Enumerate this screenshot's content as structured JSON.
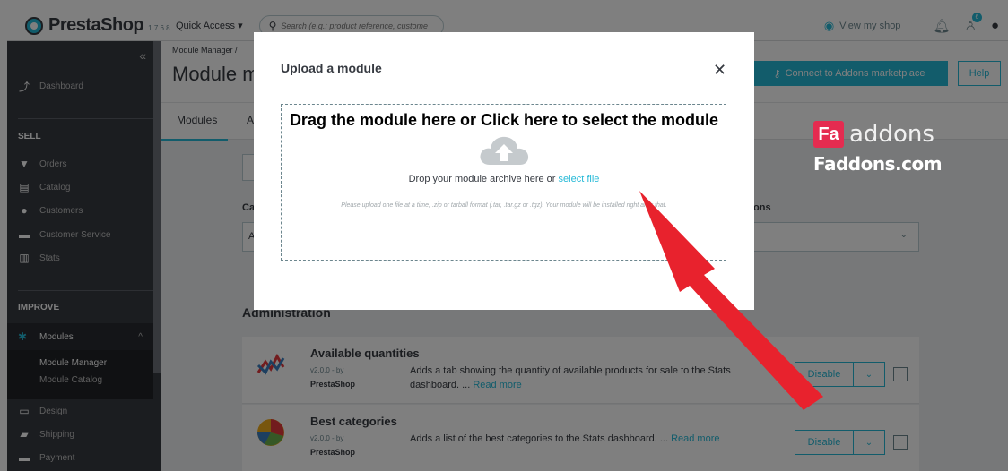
{
  "topbar": {
    "logo": "PrestaShop",
    "version": "1.7.6.8",
    "quick_access": "Quick Access ▾",
    "search_placeholder": "Search (e.g.: product reference, custome",
    "view_shop": "View my shop",
    "notif_badge": "6"
  },
  "sidebar": {
    "dashboard": "Dashboard",
    "sell": "SELL",
    "orders": "Orders",
    "catalog": "Catalog",
    "customers": "Customers",
    "customer_service": "Customer Service",
    "stats": "Stats",
    "improve": "IMPROVE",
    "modules": "Modules",
    "module_manager": "Module Manager",
    "module_catalog": "Module Catalog",
    "design": "Design",
    "shipping": "Shipping",
    "payment": "Payment"
  },
  "header": {
    "breadcrumb": "Module Manager /",
    "title": "Module m",
    "addons_button": "Connect to Addons marketplace",
    "help_button": "Help"
  },
  "tabs": {
    "modules": "Modules",
    "alerts": "A"
  },
  "filters": {
    "category_label": "Ca",
    "status_label": "ons",
    "category_value": "A"
  },
  "section_title": "Administration",
  "modules": [
    {
      "name": "Available quantities",
      "version": "v2.0.0 - by",
      "author": "PrestaShop",
      "description": "Adds a tab showing the quantity of available products for sale to the Stats dashboard. ...",
      "more": "Read more",
      "action": "Disable"
    },
    {
      "name": "Best categories",
      "version": "v2.0.0 - by",
      "author": "PrestaShop",
      "description": "Adds a list of the best categories to the Stats dashboard. ...",
      "more": "Read more",
      "action": "Disable"
    }
  ],
  "modal": {
    "title": "Upload a module",
    "banner": "Drag the module here or Click here to select the module",
    "drop_text": "Drop your module archive here or",
    "select_file": "select file",
    "hint": "Please upload one file at a time, .zip or tarball format (.tar, .tar.gz or .tgz). Your module will be installed right after that."
  },
  "watermark": {
    "fa": "Fa",
    "addons": "addons",
    "site": "Faddons.com"
  },
  "colors": {
    "accent": "#25b9d7",
    "sidebar": "#363a41",
    "arrow": "#e8222d"
  }
}
